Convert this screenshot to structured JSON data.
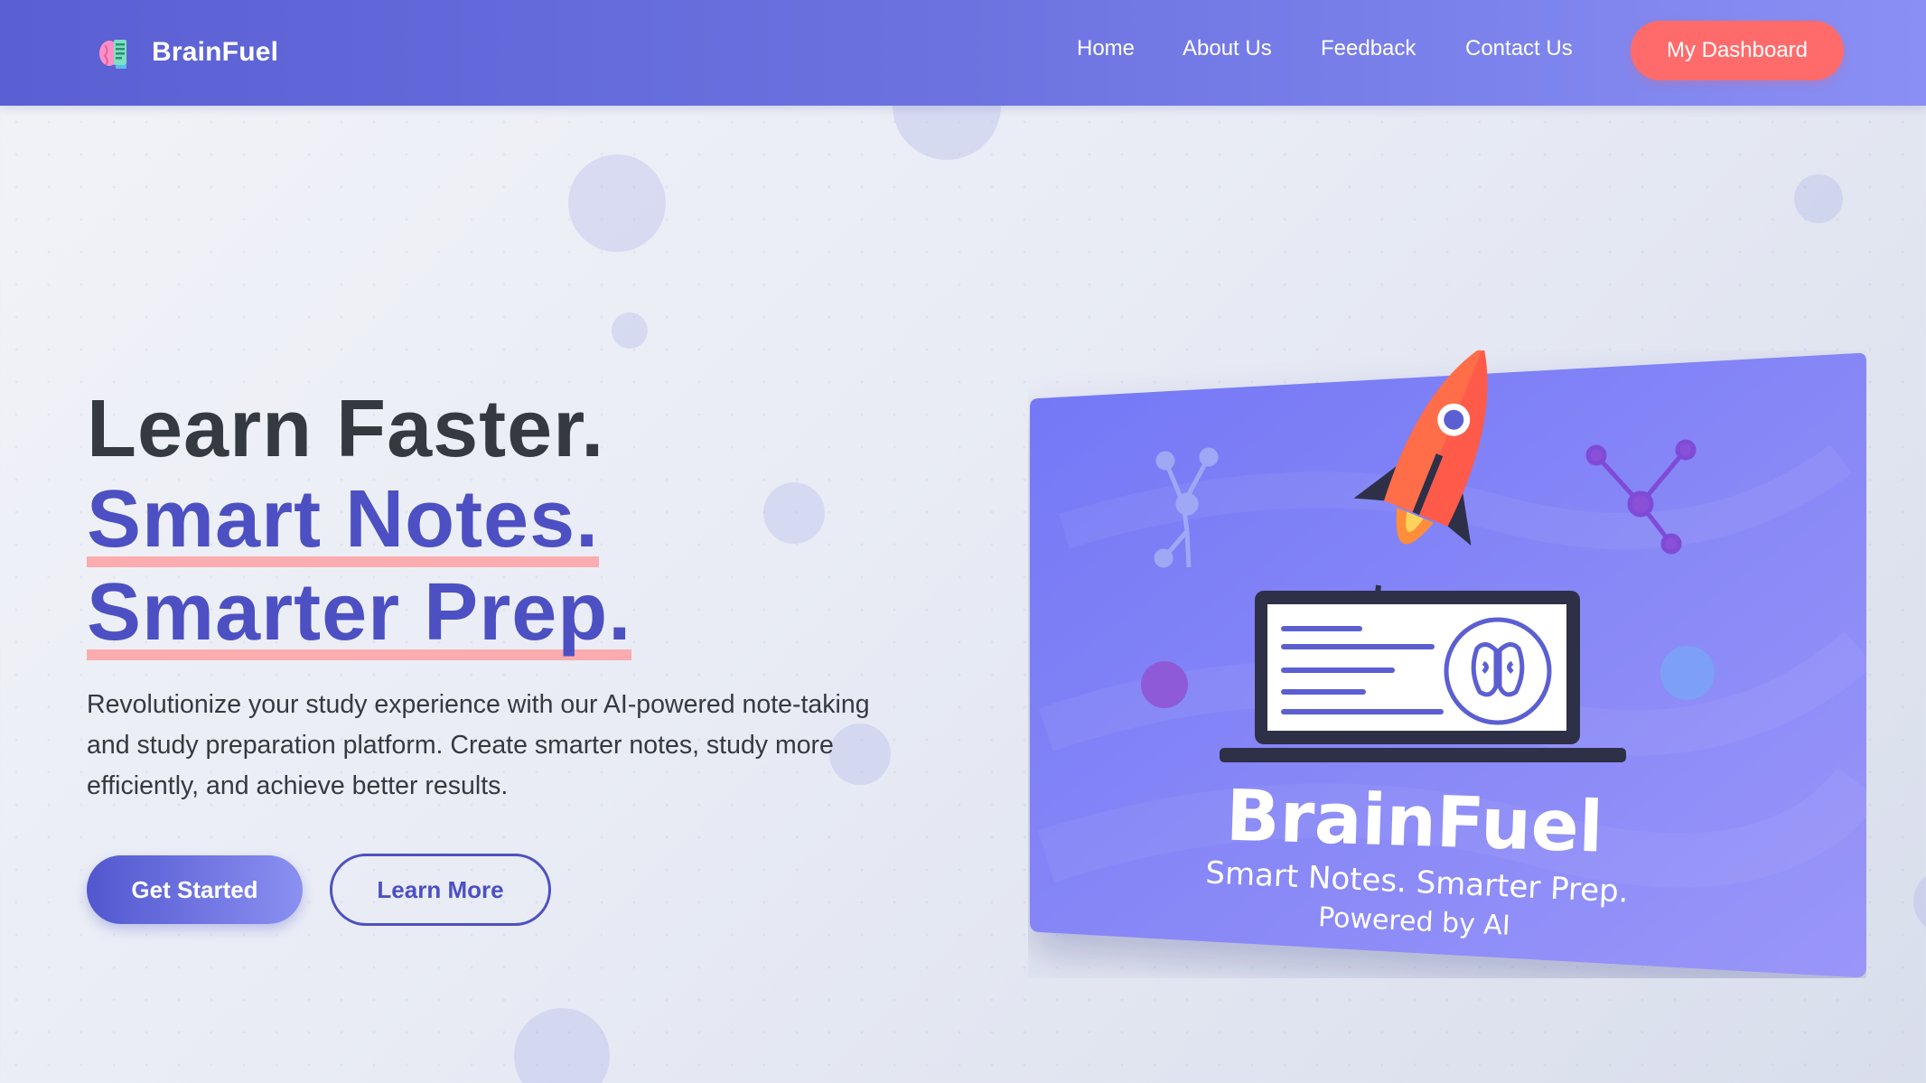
{
  "brand": {
    "name": "BrainFuel",
    "logo_icon": "brain-icon"
  },
  "nav": {
    "links": [
      "Home",
      "About Us",
      "Feedback",
      "Contact Us"
    ],
    "cta": "My Dashboard"
  },
  "hero": {
    "title_line1": "Learn Faster.",
    "title_line2": "Smart Notes.",
    "title_line3": "Smarter Prep.",
    "description": "Revolutionize your study experience with our AI-powered note-taking and study preparation platform. Create smarter notes, study more efficiently, and achieve better results.",
    "primary_button": "Get Started",
    "secondary_button": "Learn More"
  },
  "illustration": {
    "title": "BrainFuel",
    "tagline": "Smart Notes. Smarter Prep.",
    "subtitle": "Powered by AI",
    "icons": [
      "rocket-icon",
      "laptop-icon",
      "brain-icon",
      "network-node-icon"
    ]
  },
  "colors": {
    "nav_gradient_start": "#5a5fd3",
    "nav_gradient_end": "#8a8ff5",
    "accent": "#4c50c2",
    "cta": "#ff6b6b",
    "highlight_underline": "#ff9696",
    "card": "#7b7ef7"
  }
}
